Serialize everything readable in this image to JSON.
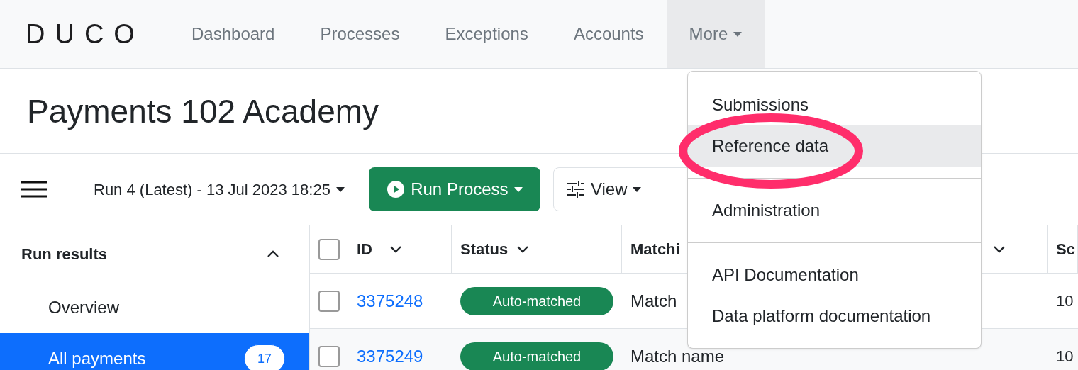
{
  "logo": "DUCO",
  "nav": {
    "items": [
      {
        "label": "Dashboard",
        "kind": "link",
        "open": false
      },
      {
        "label": "Processes",
        "kind": "link",
        "open": false
      },
      {
        "label": "Exceptions",
        "kind": "link",
        "open": false
      },
      {
        "label": "Accounts",
        "kind": "link",
        "open": false
      },
      {
        "label": "More",
        "kind": "dropdown",
        "open": true
      }
    ]
  },
  "page_title": "Payments 102 Academy",
  "toolbar": {
    "run_select": "Run 4 (Latest) - 13 Jul 2023 18:25",
    "run_button": "Run Process",
    "view_button": "View"
  },
  "sidebar": {
    "section": "Run results",
    "expanded": true,
    "items": [
      {
        "label": "Overview",
        "selected": false
      },
      {
        "label": "All payments",
        "selected": true,
        "count": "17"
      }
    ]
  },
  "table": {
    "all_checked": false,
    "columns": [
      {
        "label": "ID",
        "sortable": true
      },
      {
        "label": "Status",
        "sortable": true
      },
      {
        "label": "Matchi",
        "sortable": false
      },
      {
        "sortable": true
      },
      {
        "label": "Sc",
        "sortable": false
      }
    ],
    "rows": [
      {
        "checked": false,
        "id": "3375248",
        "status": "Auto-matched",
        "matching": "Match",
        "score": "10"
      },
      {
        "checked": false,
        "id": "3375249",
        "status": "Auto-matched",
        "matching": "Match name",
        "score": "10"
      }
    ]
  },
  "more_menu": {
    "groups": [
      [
        {
          "label": "Submissions",
          "selected": false
        },
        {
          "label": "Reference data",
          "selected": true
        }
      ],
      [
        {
          "label": "Administration",
          "selected": false
        }
      ],
      [
        {
          "label": "API Documentation",
          "selected": false
        },
        {
          "label": "Data platform documentation",
          "selected": false
        }
      ]
    ]
  },
  "annotation": {
    "kind": "ellipse"
  }
}
